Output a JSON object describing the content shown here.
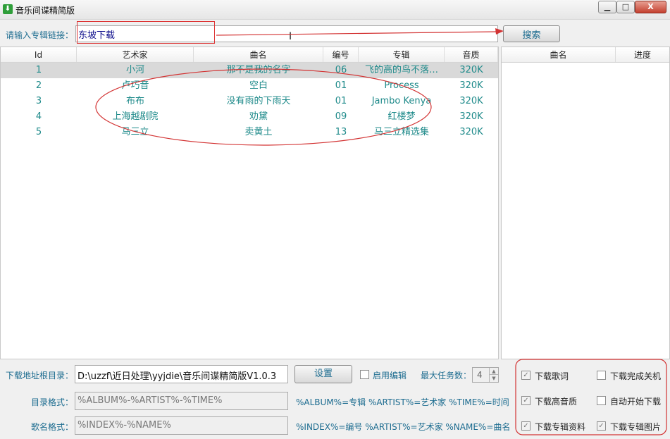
{
  "window": {
    "title": "音乐间谍精简版",
    "icon": "download-icon",
    "min_label": "▁",
    "max_label": "□",
    "close_label": "X"
  },
  "search": {
    "label": "请输入专辑链接：",
    "value": "东坡下载",
    "button_label": "搜索"
  },
  "table": {
    "columns": [
      "Id",
      "艺术家",
      "曲名",
      "编号",
      "专辑",
      "音质"
    ],
    "rows": [
      {
        "id": "1",
        "artist": "小河",
        "song": "那不是我的名字",
        "no": "06",
        "album": "飞的高的鸟不落…",
        "quality": "320K"
      },
      {
        "id": "2",
        "artist": "卢巧音",
        "song": "空白",
        "no": "01",
        "album": "Process",
        "quality": "320K"
      },
      {
        "id": "3",
        "artist": "布布",
        "song": "没有雨的下雨天",
        "no": "01",
        "album": "Jambo Kenya",
        "quality": "320K"
      },
      {
        "id": "4",
        "artist": "上海越剧院",
        "song": "劝黛",
        "no": "09",
        "album": "红楼梦",
        "quality": "320K"
      },
      {
        "id": "5",
        "artist": "马三立",
        "song": "卖黄土",
        "no": "13",
        "album": "马三立精选集",
        "quality": "320K"
      }
    ]
  },
  "download_panel": {
    "columns": [
      "曲名",
      "进度"
    ]
  },
  "settings": {
    "root_dir_label": "下载地址根目录：",
    "root_dir_value": "D:\\uzzf\\近日处理\\yyjdie\\音乐间谍精简版V1.0.3",
    "set_button_label": "设置",
    "enable_edit_label": "启用编辑",
    "max_tasks_label": "最大任务数：",
    "max_tasks_value": "4",
    "dir_format_label": "目录格式：",
    "dir_format_value": "%ALBUM%-%ARTIST%-%TIME%",
    "dir_format_hint": "%ALBUM%=专辑 %ARTIST%=艺术家 %TIME%=时间",
    "song_format_label": "歌名格式：",
    "song_format_value": "%INDEX%-%NAME%",
    "song_format_hint": "%INDEX%=编号 %ARTIST%=艺术家 %NAME%=曲名"
  },
  "options": {
    "download_lyrics": {
      "label": "下载歌词",
      "checked": true
    },
    "shutdown_after": {
      "label": "下载完成关机",
      "checked": false
    },
    "high_quality": {
      "label": "下载高音质",
      "checked": true
    },
    "auto_start": {
      "label": "自动开始下载",
      "checked": false
    },
    "album_info": {
      "label": "下载专辑资料",
      "checked": true
    },
    "album_image": {
      "label": "下载专辑图片",
      "checked": true
    }
  },
  "annotation_color": "#d33333"
}
